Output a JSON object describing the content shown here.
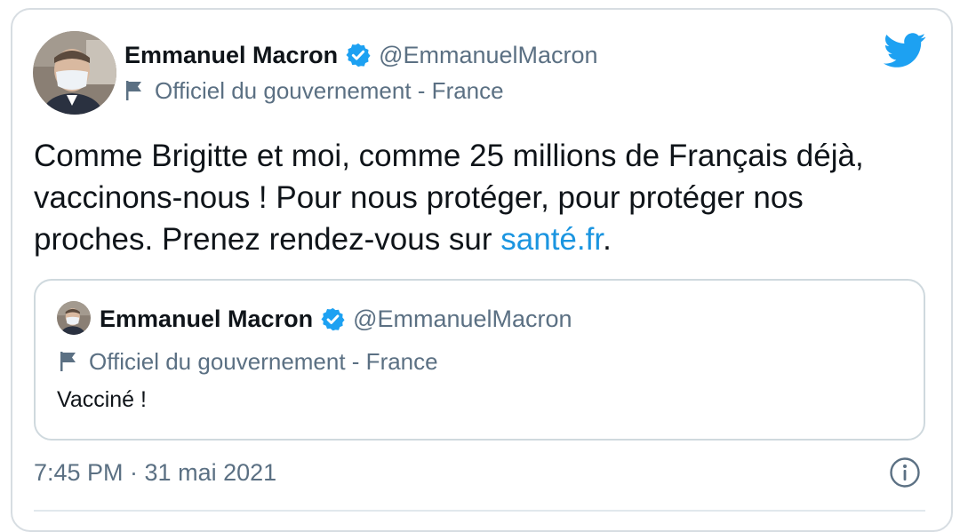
{
  "tweet": {
    "author": {
      "display_name": "Emmanuel Macron",
      "handle": "@EmmanuelMacron",
      "label": "Officiel du gouvernement - France",
      "verified": true
    },
    "text_before_link": "Comme Brigitte et moi, comme 25 millions de Français déjà, vaccinons-nous ! Pour nous protéger, pour protéger nos proches. Prenez rendez-vous sur ",
    "link_text": "santé.fr",
    "text_after_link": ".",
    "quoted": {
      "display_name": "Emmanuel Macron",
      "handle": "@EmmanuelMacron",
      "label": "Officiel du gouvernement - France",
      "text": "Vacciné !"
    },
    "timestamp": "7:45 PM · 31 mai 2021"
  },
  "icons": {
    "brand": "twitter-bird-icon",
    "verified": "verified-badge-icon",
    "label": "flag-icon",
    "info": "info-icon"
  },
  "colors": {
    "link": "#1b95e0",
    "twitter_blue": "#1da1f2",
    "secondary_text": "#5b7083",
    "primary_text": "#0f1419"
  }
}
